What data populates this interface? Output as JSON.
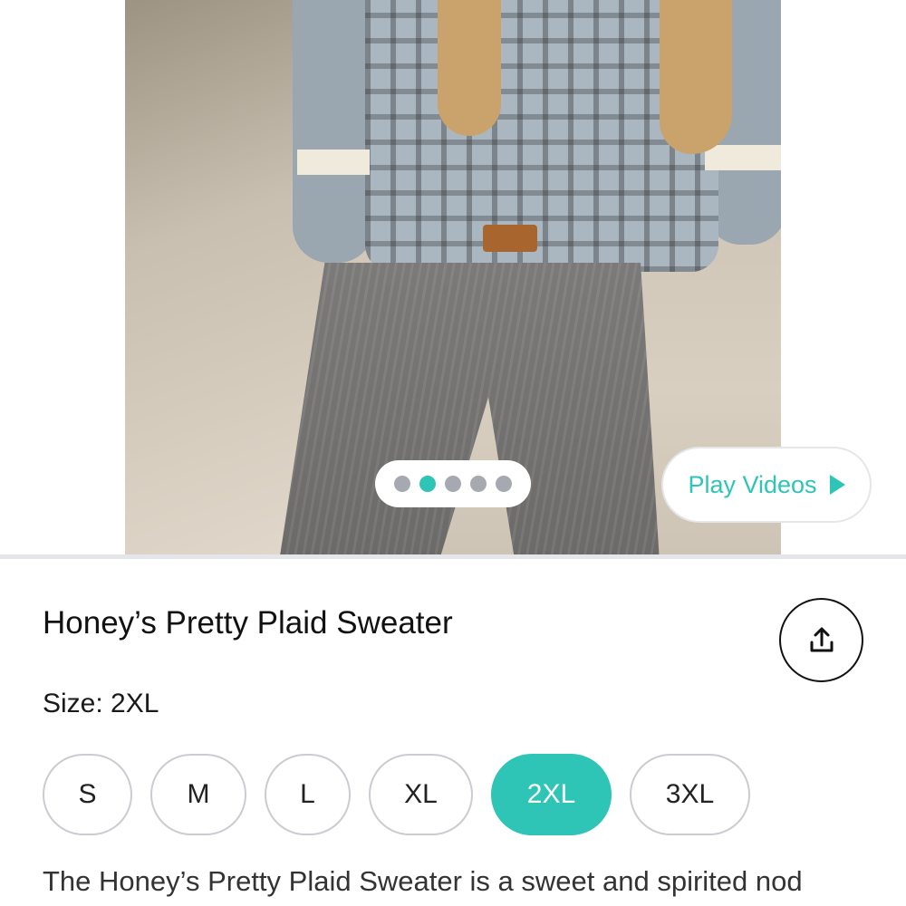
{
  "gallery": {
    "image_alt": "Model wearing plaid floral cardigan with grey herringbone trousers",
    "pager": {
      "count": 5,
      "active_index": 1
    },
    "play_videos_label": "Play Videos"
  },
  "product": {
    "title": "Honey’s Pretty Plaid Sweater",
    "size_label": "Size:",
    "selected_size": "2XL",
    "sizes": [
      "S",
      "M",
      "L",
      "XL",
      "2XL",
      "3XL"
    ],
    "description": "The Honey’s Pretty Plaid Sweater is a sweet and spirited nod"
  },
  "icons": {
    "share": "share-icon",
    "play": "play-icon"
  },
  "colors": {
    "accent": "#2ec4b6",
    "chip_border": "#c9ccd1",
    "dot_inactive": "#a6aab0"
  }
}
